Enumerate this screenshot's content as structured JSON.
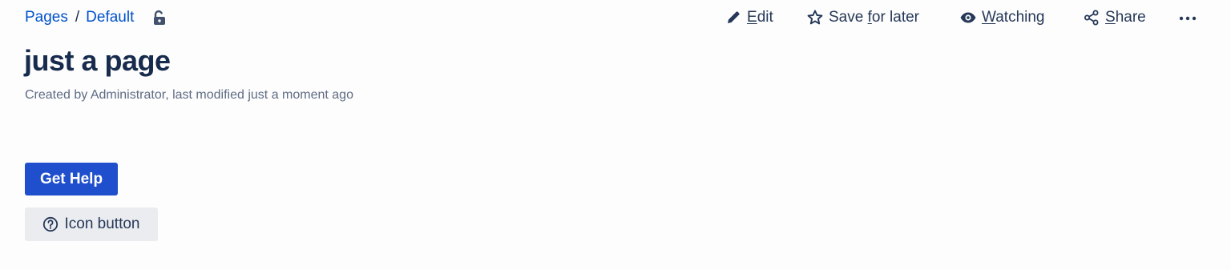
{
  "breadcrumb": {
    "items": [
      {
        "label": "Pages"
      },
      {
        "label": "Default"
      }
    ],
    "separator": "/",
    "lock_icon": "unlocked-padlock-icon"
  },
  "toolbar": {
    "edit": {
      "pre": "",
      "accel": "E",
      "post": "dit",
      "icon": "pencil-icon"
    },
    "save": {
      "pre": "Save ",
      "accel": "f",
      "post": "or later",
      "icon": "star-icon"
    },
    "watch": {
      "pre": "",
      "accel": "W",
      "post": "atching",
      "icon": "eye-icon"
    },
    "share": {
      "pre": "",
      "accel": "S",
      "post": "hare",
      "icon": "share-icon"
    },
    "more_icon": "ellipsis-icon"
  },
  "page": {
    "title": "just a page",
    "byline": "Created by Administrator, last modified just a moment ago"
  },
  "buttons": {
    "get_help": "Get Help",
    "icon_button": "Icon button",
    "icon_button_icon": "question-circle-icon"
  },
  "colors": {
    "link": "#0052cc",
    "primary_button": "#1f4fcc",
    "text": "#172b4d",
    "meta_text": "#5e6c84",
    "subtle_button": "#ebecf0"
  }
}
